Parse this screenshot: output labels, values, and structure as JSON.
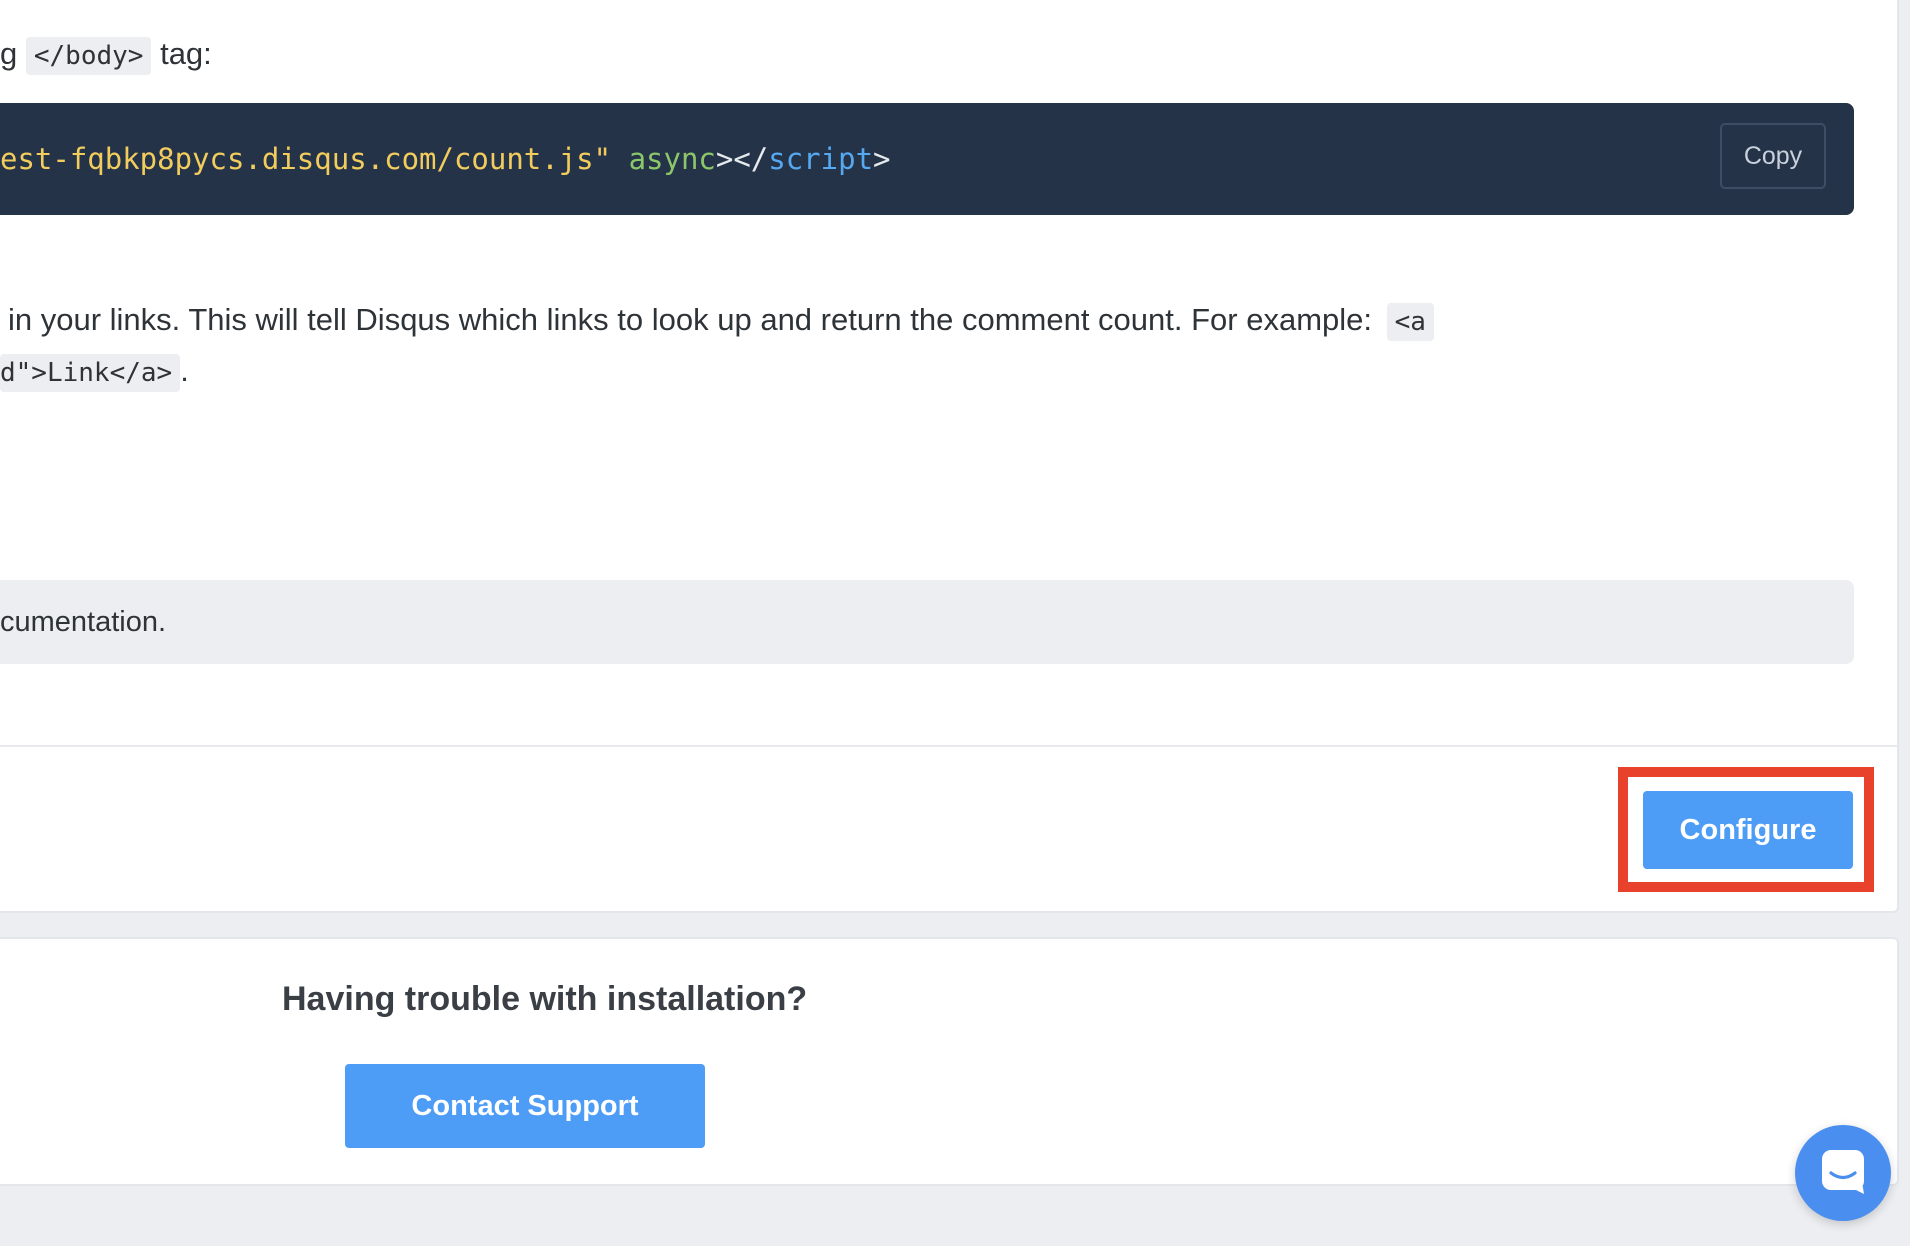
{
  "instructions": {
    "line1_prefix": "g",
    "line1_code": "</body>",
    "line1_suffix": "tag:",
    "code_snippet": {
      "string_part": "est-fqbkp8pycs.disqus.com/count.js\"",
      "attr_part": "async",
      "punct_open": "></",
      "tag_part": "script",
      "punct_close": ">"
    },
    "copy_label": "Copy",
    "line2_text": "in your links. This will tell Disqus which links to look up and return the comment count. For example:",
    "line2_code": "<a",
    "line3_code": "d\">Link</a>",
    "line3_suffix": "."
  },
  "note": {
    "text": "cumentation."
  },
  "footer": {
    "configure_label": "Configure"
  },
  "support": {
    "title": "Having trouble with installation?",
    "button_label": "Contact Support"
  },
  "chat": {
    "icon": "chat-bubble-icon"
  },
  "colors": {
    "accent": "#4d9cf6",
    "highlight": "#e8412c",
    "code_bg": "#243348"
  }
}
